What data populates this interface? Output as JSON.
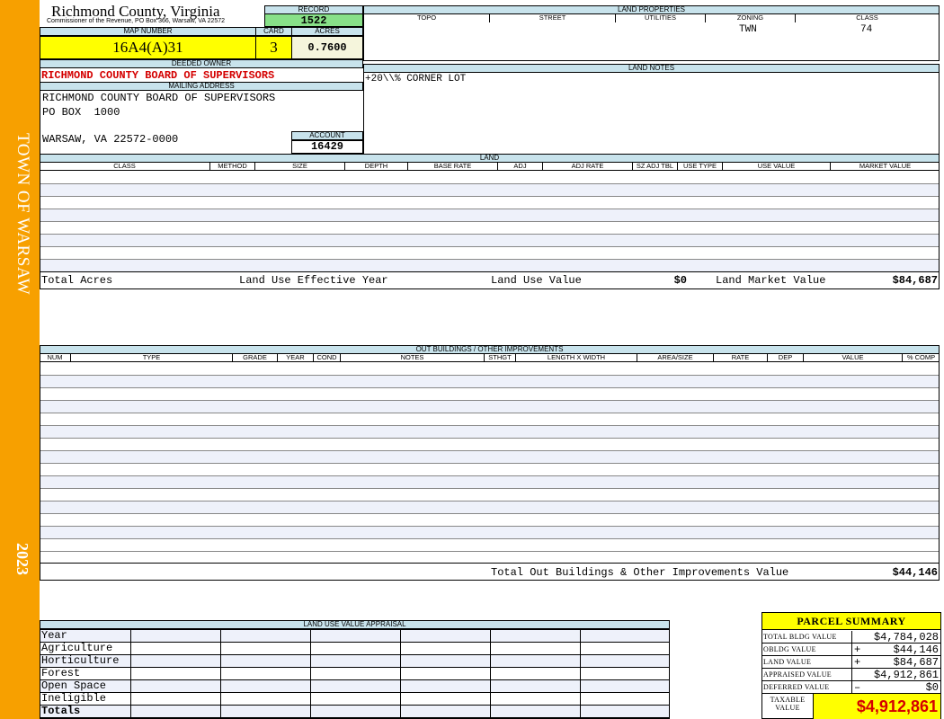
{
  "sidebar": {
    "title": "TOWN OF WARSAW",
    "year": "2023"
  },
  "header": {
    "county": "Richmond County, Virginia",
    "commissioner": "Commissioner of the Revenue, PO Box 366, Warsaw, VA 22572"
  },
  "record": {
    "label": "RECORD",
    "value": "1522"
  },
  "map": {
    "map_number_label": "MAP NUMBER",
    "map_number": "16A4(A)31",
    "card_label": "CARD",
    "card": "3",
    "acres_label": "ACRES",
    "acres": "0.7600"
  },
  "owner": {
    "deeded_owner_label": "DEEDED OWNER",
    "deeded_owner": "RICHMOND COUNTY BOARD OF SUPERVISORS",
    "mailing_address_label": "MAILING ADDRESS",
    "address_line1": "RICHMOND COUNTY BOARD OF SUPERVISORS",
    "address_line2": "PO BOX  1000",
    "address_line3": "WARSAW, VA 22572-0000",
    "account_label": "ACCOUNT",
    "account": "16429"
  },
  "land_properties": {
    "title": "LAND PROPERTIES",
    "columns": [
      "TOPO",
      "STREET",
      "UTILITIES",
      "ZONING",
      "CLASS"
    ],
    "zoning": "TWN",
    "class": "74"
  },
  "land_notes": {
    "title": "LAND NOTES",
    "text": "+20\\\\% CORNER LOT"
  },
  "land": {
    "title": "LAND",
    "columns": [
      "CLASS",
      "METHOD",
      "SIZE",
      "DEPTH",
      "BASE RATE",
      "ADJ",
      "ADJ RATE",
      "SZ ADJ TBL",
      "USE TYPE",
      "USE VALUE",
      "MARKET VALUE"
    ],
    "total_acres_label": "Total Acres",
    "effective_year_label": "Land Use Effective Year",
    "use_value_label": "Land Use Value",
    "use_value": "$0",
    "market_value_label": "Land Market Value",
    "market_value": "$84,687"
  },
  "outbuildings": {
    "title": "OUT BUILDINGS / OTHER IMPROVEMENTS",
    "columns": [
      "NUM",
      "TYPE",
      "GRADE",
      "YEAR",
      "COND",
      "NOTES",
      "STHGT",
      "LENGTH X WIDTH",
      "AREA/SIZE",
      "RATE",
      "DEP",
      "VALUE",
      "% COMP"
    ],
    "total_label": "Total Out Buildings & Other Improvements Value",
    "total_value": "$44,146"
  },
  "land_use_appraisal": {
    "title": "LAND USE VALUE APPRAISAL",
    "rows": [
      "Year",
      "Agriculture",
      "Horticulture",
      "Forest",
      "Open Space",
      "Ineligible",
      "Totals"
    ]
  },
  "parcel_summary": {
    "title": "PARCEL SUMMARY",
    "rows": [
      {
        "label": "TOTAL BLDG VALUE",
        "sign": "",
        "value": "$4,784,028"
      },
      {
        "label": "OBLDG VALUE",
        "sign": "+",
        "value": "$44,146"
      },
      {
        "label": "LAND VALUE",
        "sign": "+",
        "value": "$84,687"
      },
      {
        "label": "APPRAISED VALUE",
        "sign": "",
        "value": "$4,912,861"
      },
      {
        "label": "DEFERRED VALUE",
        "sign": "–",
        "value": "$0"
      }
    ],
    "taxable_label_1": "TAXABLE",
    "taxable_label_2": "VALUE",
    "taxable_value": "$4,912,861"
  },
  "colors": {
    "sidebar": "#f7a000",
    "header_band": "#c8e3ec",
    "yellow": "#ffff00",
    "green": "#88e088",
    "red": "#d40000"
  }
}
